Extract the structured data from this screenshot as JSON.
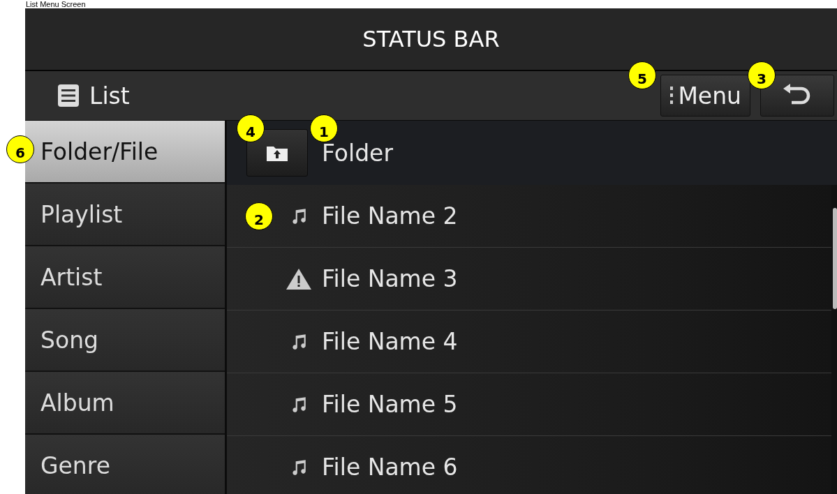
{
  "caption": "List Menu Screen",
  "status_bar": {
    "title": "STATUS BAR"
  },
  "header": {
    "title": "List",
    "menu_button": "Menu"
  },
  "sidebar": {
    "items": [
      {
        "label": "Folder/File",
        "selected": true
      },
      {
        "label": "Playlist",
        "selected": false
      },
      {
        "label": "Artist",
        "selected": false
      },
      {
        "label": "Song",
        "selected": false
      },
      {
        "label": "Album",
        "selected": false
      },
      {
        "label": "Genre",
        "selected": false
      }
    ]
  },
  "folder": {
    "title": "Folder"
  },
  "files": [
    {
      "name": "File Name 2",
      "kind": "music"
    },
    {
      "name": "File Name 3",
      "kind": "warning"
    },
    {
      "name": "File Name 4",
      "kind": "music"
    },
    {
      "name": "File Name 5",
      "kind": "music"
    },
    {
      "name": "File Name 6",
      "kind": "music"
    }
  ],
  "callouts": [
    "1",
    "2",
    "3",
    "4",
    "5",
    "6"
  ]
}
